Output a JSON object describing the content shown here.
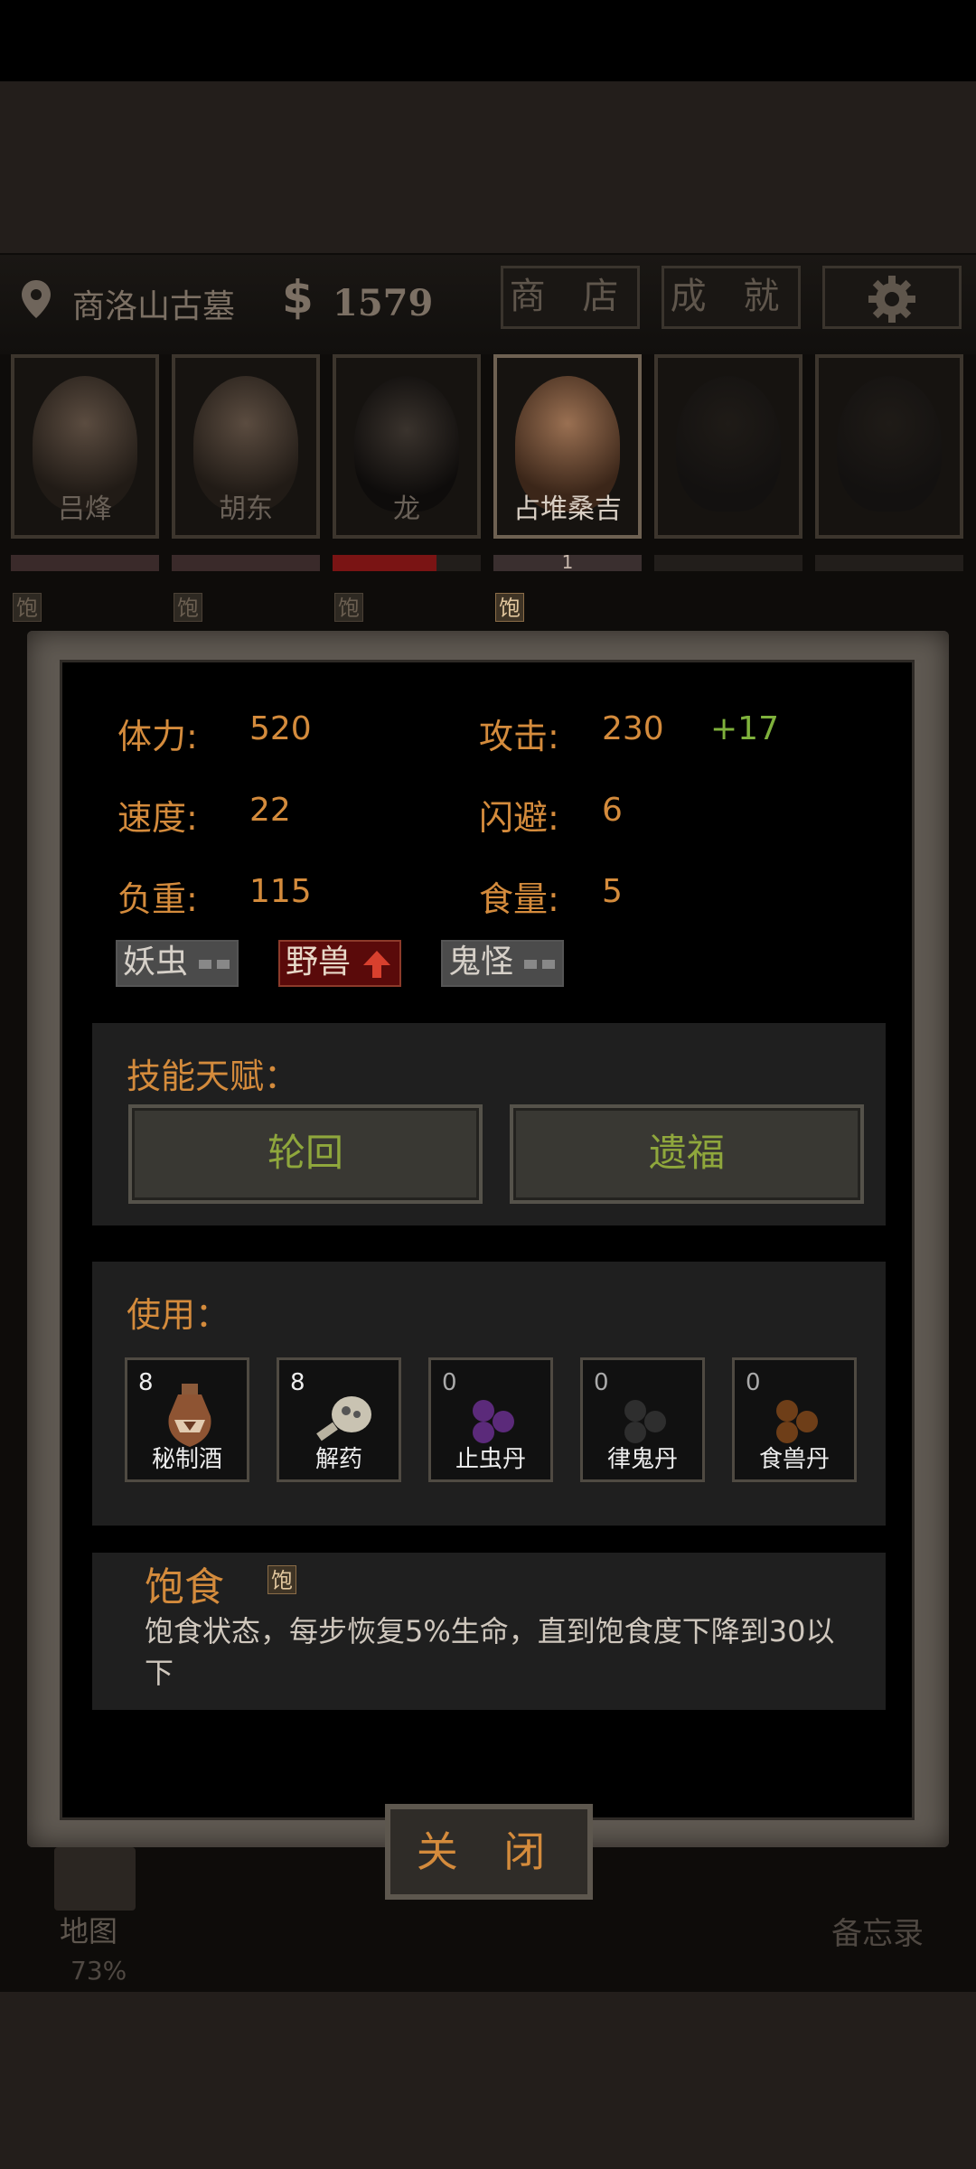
{
  "hud": {
    "location": "商洛山古墓",
    "currency_symbol": "$",
    "money": "1579",
    "shop_label": "商 店",
    "achievements_label": "成 就"
  },
  "party": [
    {
      "name": "吕烽"
    },
    {
      "name": "胡东"
    },
    {
      "name": "龙"
    },
    {
      "name": "占堆桑吉",
      "active_badge": "1"
    },
    {
      "name": ""
    },
    {
      "name": ""
    }
  ],
  "satiety_badge": "饱",
  "stats": {
    "stamina_label": "体力:",
    "stamina": "520",
    "attack_label": "攻击:",
    "attack": "230",
    "attack_bonus": "+17",
    "speed_label": "速度:",
    "speed": "22",
    "dodge_label": "闪避:",
    "dodge": "6",
    "load_label": "负重:",
    "load": "115",
    "food_label": "食量:",
    "food": "5"
  },
  "resistances": [
    {
      "label": "妖虫",
      "state": "neutral"
    },
    {
      "label": "野兽",
      "state": "up"
    },
    {
      "label": "鬼怪",
      "state": "neutral"
    }
  ],
  "skills": {
    "title": "技能天赋：",
    "items": [
      "轮回",
      "遗福"
    ]
  },
  "use": {
    "title": "使用：",
    "items": [
      {
        "count": "8",
        "label": "秘制酒",
        "icon": "wine-jar-icon"
      },
      {
        "count": "8",
        "label": "解药",
        "icon": "antidote-bottle-icon"
      },
      {
        "count": "0",
        "label": "止虫丹",
        "icon": "purple-pills-icon"
      },
      {
        "count": "0",
        "label": "律鬼丹",
        "icon": "black-pills-icon"
      },
      {
        "count": "0",
        "label": "食兽丹",
        "icon": "brown-pills-icon"
      }
    ]
  },
  "status": {
    "title": "饱食",
    "badge": "饱",
    "description": "饱食状态，每步恢复5%生命，直到饱食度下降到30以下"
  },
  "bottom": {
    "map_label": "地图",
    "map_percent": "73%",
    "memo_label": "备忘录"
  },
  "close_label": "关 闭",
  "colors": {
    "accent": "#d48b3c",
    "skill_text": "#8fa73c",
    "bonus": "#7fb13c"
  }
}
